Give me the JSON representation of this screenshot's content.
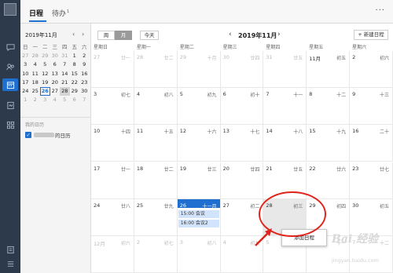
{
  "tabs": [
    {
      "label": "日程",
      "active": true
    },
    {
      "label": "待办",
      "badge": "1",
      "active": false
    }
  ],
  "more_label": "···",
  "mini_calendar": {
    "title": "2019年11月",
    "prev": "‹",
    "next": "›",
    "weekdays": [
      "日",
      "一",
      "二",
      "三",
      "四",
      "五",
      "六"
    ],
    "weeks": [
      [
        "27",
        "28",
        "29",
        "30",
        "31",
        "1",
        "2"
      ],
      [
        "3",
        "4",
        "5",
        "6",
        "7",
        "8",
        "9"
      ],
      [
        "10",
        "11",
        "12",
        "13",
        "14",
        "15",
        "16"
      ],
      [
        "17",
        "18",
        "19",
        "20",
        "21",
        "22",
        "23"
      ],
      [
        "24",
        "25",
        "26",
        "27",
        "28",
        "29",
        "30"
      ],
      [
        "1",
        "2",
        "3",
        "4",
        "5",
        "6",
        "7"
      ]
    ],
    "today": "26",
    "selected": "28"
  },
  "my_calendars": {
    "title": "我的日历",
    "items": [
      {
        "label": "的日历",
        "checked": true
      }
    ]
  },
  "toolbar": {
    "week_label": "周",
    "month_label": "月",
    "today_label": "今天",
    "month_title": "2019年11月",
    "prev": "‹",
    "next": "›",
    "new_event_label": "+ 新建日程"
  },
  "weekday_headers": [
    "星期日",
    "星期一",
    "星期二",
    "星期三",
    "星期四",
    "星期五",
    "星期六"
  ],
  "weeks": [
    [
      [
        "27",
        "廿一",
        true
      ],
      [
        "28",
        "廿二",
        true
      ],
      [
        "29",
        "十月",
        true
      ],
      [
        "30",
        "廿四",
        true
      ],
      [
        "31",
        "廿五",
        true
      ],
      [
        "11月",
        "初五",
        false
      ],
      [
        "2",
        "初六",
        false
      ]
    ],
    [
      [
        "3",
        "初七",
        false
      ],
      [
        "4",
        "初八",
        false
      ],
      [
        "5",
        "初九",
        false
      ],
      [
        "6",
        "初十",
        false
      ],
      [
        "7",
        "十一",
        false
      ],
      [
        "8",
        "十二",
        false
      ],
      [
        "9",
        "十三",
        false
      ]
    ],
    [
      [
        "10",
        "十四",
        false
      ],
      [
        "11",
        "十五",
        false
      ],
      [
        "12",
        "十六",
        false
      ],
      [
        "13",
        "十七",
        false
      ],
      [
        "14",
        "十八",
        false
      ],
      [
        "15",
        "十九",
        false
      ],
      [
        "16",
        "二十",
        false
      ]
    ],
    [
      [
        "17",
        "廿一",
        false
      ],
      [
        "18",
        "廿二",
        false
      ],
      [
        "19",
        "廿三",
        false
      ],
      [
        "20",
        "廿四",
        false
      ],
      [
        "21",
        "廿五",
        false
      ],
      [
        "22",
        "廿六",
        false
      ],
      [
        "23",
        "廿七",
        false
      ]
    ],
    [
      [
        "24",
        "廿八",
        false
      ],
      [
        "25",
        "廿九",
        false
      ],
      [
        "26",
        "十一月",
        false
      ],
      [
        "27",
        "初二",
        false
      ],
      [
        "28",
        "初三",
        false
      ],
      [
        "29",
        "初四",
        false
      ],
      [
        "30",
        "初五",
        false
      ]
    ],
    [
      [
        "12月",
        "初六",
        true
      ],
      [
        "2",
        "初七",
        true
      ],
      [
        "3",
        "初八",
        true
      ],
      [
        "4",
        "初九",
        true
      ],
      [
        "5",
        "初十",
        true
      ],
      [
        "6",
        "十一",
        true
      ],
      [
        "7",
        "十二",
        true
      ]
    ]
  ],
  "events": [
    {
      "label": "15:00 会议"
    },
    {
      "label": "16:00 会议2"
    }
  ],
  "popup_label": "添加日程",
  "watermark": {
    "logo": "Bai 经验",
    "sub": "经验",
    "url": "jingyan.baidu.com"
  },
  "colors": {
    "accent": "#1f6fd1",
    "rail": "#2d3a4b",
    "annotation": "#e0241b"
  }
}
